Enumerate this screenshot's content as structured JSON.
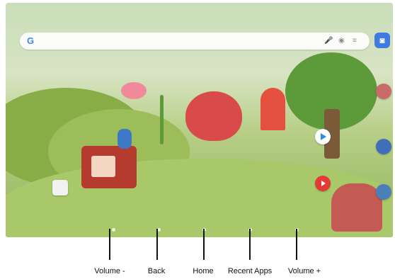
{
  "nav_labels": {
    "volume_down": "Volume -",
    "back": "Back",
    "home": "Home",
    "recent_apps": "Recent Apps",
    "volume_up": "Volume +"
  },
  "icons": {
    "search_mic": "mic-icon",
    "search_lens": "lens-icon",
    "camera": "camera-icon",
    "play_store": "play-store-icon",
    "youtube": "youtube-icon"
  },
  "colors": {
    "camera": "#3d7be0",
    "youtube": "#e53935",
    "play": "#2f8be6"
  }
}
